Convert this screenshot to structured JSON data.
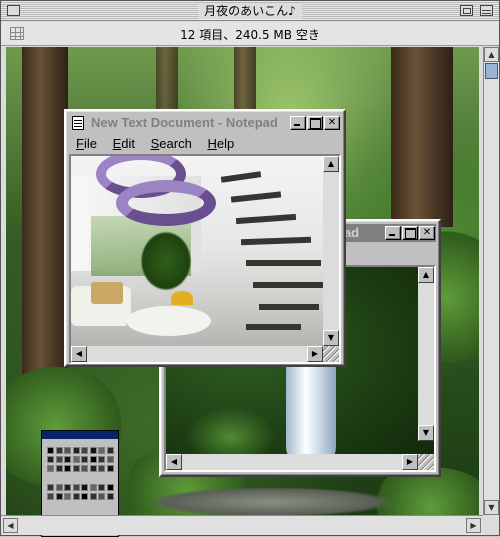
{
  "finder_window": {
    "title": "月夜のあいこん♪",
    "info_text": "12 項目、240.5 MB 空き"
  },
  "notepad_window": {
    "title": "New Text Document - Notepad",
    "menus": [
      {
        "underline": "F",
        "rest": "ile"
      },
      {
        "underline": "E",
        "rest": "dit"
      },
      {
        "underline": "S",
        "rest": "earch"
      },
      {
        "underline": "H",
        "rest": "elp"
      }
    ]
  },
  "background_window": {
    "title_fragment": "pad"
  },
  "colors": {
    "inactive_title": "#808080",
    "window_face": "#c0c0c0",
    "palette_title": "#0a246a"
  }
}
